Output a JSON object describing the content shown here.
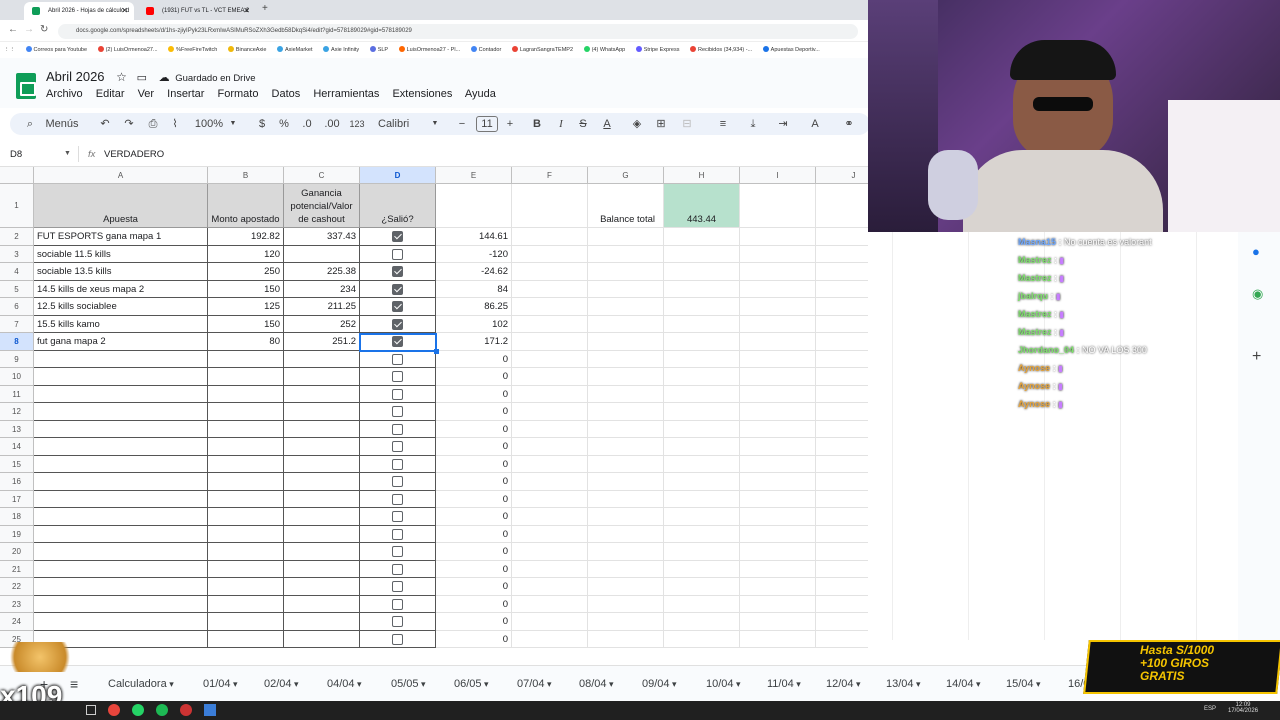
{
  "browser": {
    "tabs": [
      {
        "label": "Abril 2026 - Hojas de cálculo d",
        "active": true
      },
      {
        "label": "(1931) FUT vs TL - VCT EMEA 2",
        "active": false
      }
    ],
    "url": "docs.google.com/spreadsheets/d/1hs-zjiyIPyk23LRxmIwASIMuRSoZXh3Gedb58DkqSi4/edit?gid=578189029#gid=578189029",
    "bookmarks": [
      "Correos para Youtube",
      "(2) LuisOrmenoa27...",
      "%FreeFireTwitch",
      "BinanceAxie",
      "AxieMarket",
      "Axie Infinity",
      "SLP",
      "LuisOrmenoa27 - Pl...",
      "Contador",
      "LagranSangraTEMP2",
      "(4) WhatsApp",
      "Stripe Express",
      "Recibidos (34,934) -...",
      "Apuestas Deportiv..."
    ]
  },
  "doc": {
    "title": "Abril 2026",
    "status": "Guardado en Drive",
    "menus": [
      "Archivo",
      "Editar",
      "Ver",
      "Insertar",
      "Formato",
      "Datos",
      "Herramientas",
      "Extensiones",
      "Ayuda"
    ]
  },
  "toolbar": {
    "search": "Menús",
    "zoom": "100%",
    "currency": "$",
    "percent": "%",
    "dec_down": ".0",
    "dec_up": ".00",
    "format": "123",
    "font": "Calibri",
    "font_size": "11"
  },
  "formula": {
    "cell_ref": "D8",
    "fx": "fx",
    "value": "VERDADERO"
  },
  "columns": [
    "A",
    "B",
    "C",
    "D",
    "E",
    "F",
    "G",
    "H",
    "I",
    "J"
  ],
  "headers": {
    "a": "Apuesta",
    "b": "Monto apostado",
    "c": "Ganancia potencial/Valor de cashout",
    "d": "¿Salió?",
    "g": "Balance total",
    "h": "443.44"
  },
  "rows": [
    {
      "n": "2",
      "a": "FUT ESPORTS gana mapa 1",
      "b": "192.82",
      "c": "337.43",
      "d": true,
      "e": "144.61"
    },
    {
      "n": "3",
      "a": "sociable 11.5 kills",
      "b": "120",
      "c": "",
      "d": false,
      "e": "-120"
    },
    {
      "n": "4",
      "a": "sociable 13.5 kills",
      "b": "250",
      "c": "225.38",
      "d": true,
      "e": "-24.62"
    },
    {
      "n": "5",
      "a": "14.5 kills de xeus mapa 2",
      "b": "150",
      "c": "234",
      "d": true,
      "e": "84"
    },
    {
      "n": "6",
      "a": "12.5 kills sociablee",
      "b": "125",
      "c": "211.25",
      "d": true,
      "e": "86.25"
    },
    {
      "n": "7",
      "a": "15.5 kills kamo",
      "b": "150",
      "c": "252",
      "d": true,
      "e": "102"
    },
    {
      "n": "8",
      "a": "fut gana mapa 2",
      "b": "80",
      "c": "251.2",
      "d": true,
      "e": "171.2"
    },
    {
      "n": "9",
      "a": "",
      "b": "",
      "c": "",
      "d": false,
      "e": "0"
    },
    {
      "n": "10",
      "a": "",
      "b": "",
      "c": "",
      "d": false,
      "e": "0"
    },
    {
      "n": "11",
      "a": "",
      "b": "",
      "c": "",
      "d": false,
      "e": "0"
    },
    {
      "n": "12",
      "a": "",
      "b": "",
      "c": "",
      "d": false,
      "e": "0"
    },
    {
      "n": "13",
      "a": "",
      "b": "",
      "c": "",
      "d": false,
      "e": "0"
    },
    {
      "n": "14",
      "a": "",
      "b": "",
      "c": "",
      "d": false,
      "e": "0"
    },
    {
      "n": "15",
      "a": "",
      "b": "",
      "c": "",
      "d": false,
      "e": "0"
    },
    {
      "n": "16",
      "a": "",
      "b": "",
      "c": "",
      "d": false,
      "e": "0"
    },
    {
      "n": "17",
      "a": "",
      "b": "",
      "c": "",
      "d": false,
      "e": "0"
    },
    {
      "n": "18",
      "a": "",
      "b": "",
      "c": "",
      "d": false,
      "e": "0"
    },
    {
      "n": "19",
      "a": "",
      "b": "",
      "c": "",
      "d": false,
      "e": "0"
    },
    {
      "n": "20",
      "a": "",
      "b": "",
      "c": "",
      "d": false,
      "e": "0"
    },
    {
      "n": "21",
      "a": "",
      "b": "",
      "c": "",
      "d": false,
      "e": "0"
    },
    {
      "n": "22",
      "a": "",
      "b": "",
      "c": "",
      "d": false,
      "e": "0"
    },
    {
      "n": "23",
      "a": "",
      "b": "",
      "c": "",
      "d": false,
      "e": "0"
    },
    {
      "n": "24",
      "a": "",
      "b": "",
      "c": "",
      "d": false,
      "e": "0"
    },
    {
      "n": "25",
      "a": "",
      "b": "",
      "c": "",
      "d": false,
      "e": "0"
    }
  ],
  "sheet_tabs": [
    "Calculadora",
    "01/04",
    "02/04",
    "04/04",
    "05/05",
    "06/05",
    "07/04",
    "08/04",
    "09/04",
    "10/04",
    "11/04",
    "12/04",
    "13/04",
    "14/04",
    "15/04",
    "16/0"
  ],
  "chat": [
    {
      "user": "Masna15",
      "msg": "No cuenta es valorant",
      "color": "#6ea8ff"
    },
    {
      "user": "Mastrez",
      "msg": "",
      "color": "#7ee06c"
    },
    {
      "user": "Mastrez",
      "msg": "",
      "color": "#7ee06c"
    },
    {
      "user": "jbalrqu",
      "msg": "",
      "color": "#7ee06c"
    },
    {
      "user": "Mastrez",
      "msg": "",
      "color": "#7ee06c"
    },
    {
      "user": "Mastrez",
      "msg": "",
      "color": "#7ee06c"
    },
    {
      "user": "Jhordano_04",
      "msg": "NO VA LOS 300",
      "color": "#7ee06c"
    },
    {
      "user": "Aynose",
      "msg": "",
      "color": "#e5a33a"
    },
    {
      "user": "Aynose",
      "msg": "",
      "color": "#e5a33a"
    },
    {
      "user": "Aynose",
      "msg": "",
      "color": "#e5a33a"
    }
  ],
  "promo": {
    "line1": "Hasta S/1000",
    "line2": "+100 GIROS",
    "line3": "GRATIS"
  },
  "overlay_counter": "x109",
  "taskbar": {
    "time": "12:09",
    "date": "17/04/2026",
    "lang": "ESP"
  },
  "colors": {
    "sheets_green": "#0f9d58",
    "selected": "#1a73e8",
    "balance_fill": "#b7e1cd",
    "header_fill": "#d9d9d9"
  }
}
